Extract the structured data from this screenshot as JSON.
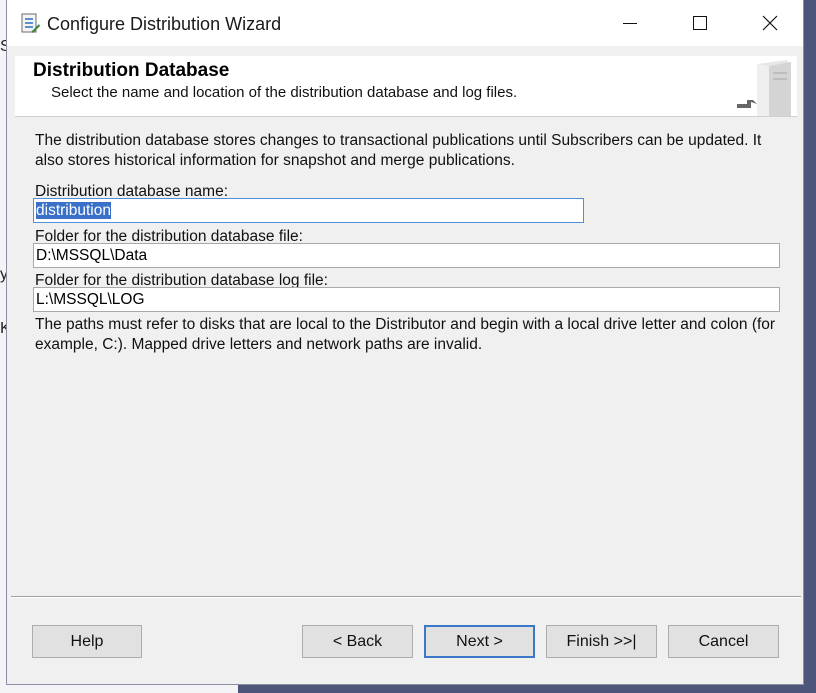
{
  "window": {
    "title": "Configure Distribution Wizard"
  },
  "header": {
    "title": "Distribution Database",
    "subtitle": "Select the name and location of the distribution database and log files."
  },
  "description": "The distribution database stores changes to transactional publications until Subscribers can be updated. It also stores historical information for snapshot and merge publications.",
  "form": {
    "db_name_label": "Distribution database name:",
    "db_name_value": "distribution",
    "db_folder_label": "Folder for the distribution database file:",
    "db_folder_value": "D:\\MSSQL\\Data",
    "log_folder_label": "Folder for the distribution database log file:",
    "log_folder_value": "L:\\MSSQL\\LOG"
  },
  "note": "The paths must refer to disks that are local to the Distributor and begin with a local drive letter and colon (for example, C:). Mapped drive letters and network paths are invalid.",
  "buttons": {
    "help": "Help",
    "back": "< Back",
    "next": "Next >",
    "finish": "Finish >>|",
    "cancel": "Cancel"
  },
  "background": {
    "frag1": "S",
    "frag2": "y",
    "frag3": "K"
  },
  "icons": {
    "app": "wizard-app-icon",
    "minimize": "minimize-icon",
    "maximize": "maximize-icon",
    "close": "close-icon",
    "header": "server-database-graphic"
  }
}
